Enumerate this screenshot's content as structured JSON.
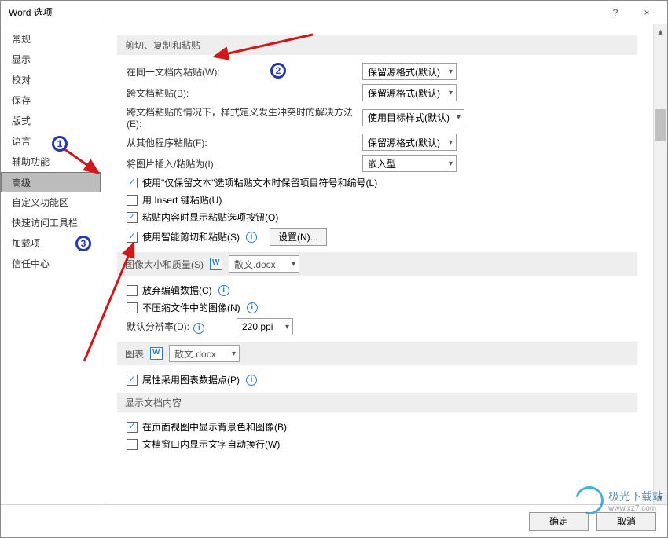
{
  "window": {
    "title": "Word 选项",
    "help_hint": "?",
    "close_hint": "×"
  },
  "sidebar": {
    "items": [
      {
        "label": "常规",
        "selected": false
      },
      {
        "label": "显示",
        "selected": false
      },
      {
        "label": "校对",
        "selected": false
      },
      {
        "label": "保存",
        "selected": false
      },
      {
        "label": "版式",
        "selected": false
      },
      {
        "label": "语言",
        "selected": false
      },
      {
        "label": "辅助功能",
        "selected": false
      },
      {
        "label": "高级",
        "selected": true
      },
      {
        "label": "自定义功能区",
        "selected": false
      },
      {
        "label": "快速访问工具栏",
        "selected": false
      },
      {
        "label": "加载项",
        "selected": false
      },
      {
        "label": "信任中心",
        "selected": false
      }
    ]
  },
  "sections": {
    "cut_copy_paste": {
      "header": "剪切、复制和粘贴",
      "paste_same_doc": {
        "label": "在同一文档内粘贴(W):",
        "value": "保留源格式(默认)"
      },
      "paste_cross_doc": {
        "label": "跨文档粘贴(B):",
        "value": "保留源格式(默认)"
      },
      "paste_cross_conflict": {
        "label": "跨文档粘贴的情况下，样式定义发生冲突时的解决方法(E):",
        "value": "使用目标样式(默认)"
      },
      "paste_other_app": {
        "label": "从其他程序粘贴(F):",
        "value": "保留源格式(默认)"
      },
      "insert_paste_pic": {
        "label": "将图片插入/粘贴为(I):",
        "value": "嵌入型"
      },
      "keep_bullets": {
        "label": "使用\"仅保留文本\"选项粘贴文本时保留项目符号和编号(L)",
        "checked": true
      },
      "insert_key": {
        "label": "用 Insert 键粘贴(U)",
        "checked": false
      },
      "show_paste_btn": {
        "label": "粘贴内容时显示粘贴选项按钮(O)",
        "checked": true
      },
      "smart_cut": {
        "label": "使用智能剪切和粘贴(S)",
        "checked": true
      },
      "settings_btn": "设置(N)..."
    },
    "image_quality": {
      "header": "图像大小和质量(S)",
      "doc_select": "散文.docx",
      "discard_edit": {
        "label": "放弃编辑数据(C)",
        "checked": false
      },
      "no_compress": {
        "label": "不压缩文件中的图像(N)",
        "checked": false
      },
      "default_res": {
        "label": "默认分辨率(D):",
        "value": "220 ppi"
      }
    },
    "chart": {
      "header": "图表",
      "doc_select": "散文.docx",
      "use_chart_datapoint": {
        "label": "属性采用图表数据点(P)",
        "checked": true
      }
    },
    "display_doc": {
      "header": "显示文档内容",
      "bg_colors": {
        "label": "在页面视图中显示背景色和图像(B)",
        "checked": true
      },
      "auto_wrap": {
        "label": "文档窗口内显示文字自动换行(W)",
        "checked": false
      }
    }
  },
  "footer": {
    "ok": "确定",
    "cancel": "取消"
  },
  "watermark": {
    "text": "极光下载站",
    "sub": "www.xz7.com"
  },
  "badges": {
    "b1": "1",
    "b2": "2",
    "b3": "3"
  }
}
